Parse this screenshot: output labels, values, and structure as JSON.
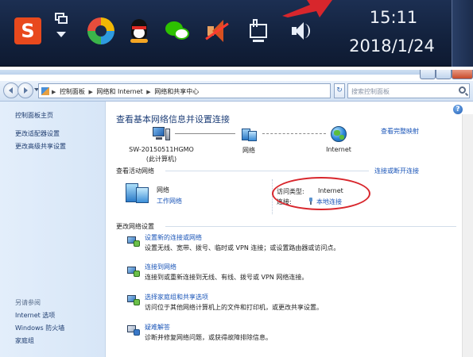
{
  "taskbar": {
    "time": "15:11",
    "date": "2018/1/24",
    "icons": [
      "sogou-input-icon",
      "switch-windows-icon",
      "colorful-ball-icon",
      "qq-icon",
      "wechat-icon",
      "speaker-muted-icon",
      "network-icon",
      "volume-icon"
    ],
    "sogou_glyph": "S",
    "annotation_color": "#d8262c"
  },
  "address_bar": {
    "crumbs": [
      "控制面板",
      "网络和 Internet",
      "网络和共享中心"
    ],
    "search_placeholder": "搜索控制面板"
  },
  "left_pane": {
    "home": "控制面板主页",
    "adapter": "更改适配器设置",
    "sharing": "更改高级共享设置",
    "see_also": "另请参阅",
    "internet_options": "Internet 选项",
    "firewall": "Windows 防火墙",
    "homegroup": "家庭组"
  },
  "main": {
    "title": "查看基本网络信息并设置连接",
    "full_map": "查看完整映射",
    "map": {
      "computer_name": "SW-20150511HGMO",
      "computer_sub": "(此计算机)",
      "network": "网络",
      "internet": "Internet"
    },
    "active": {
      "header": "查看活动网络",
      "connect_link": "连接或断开连接",
      "network_name": "网络",
      "network_type": "工作网络",
      "access_label": "访问类型:",
      "access_value": "Internet",
      "connections_label": "连接:",
      "connections_value": "本地连接"
    },
    "change": {
      "header": "更改网络设置",
      "tasks": [
        {
          "link": "设置新的连接或网络",
          "desc": "设置无线、宽带、拨号、临时或 VPN 连接；或设置路由器或访问点。"
        },
        {
          "link": "连接到网络",
          "desc": "连接到或重新连接到无线、有线、拨号或 VPN 网络连接。"
        },
        {
          "link": "选择家庭组和共享选项",
          "desc": "访问位于其他网络计算机上的文件和打印机，或更改共享设置。"
        },
        {
          "link": "疑难解答",
          "desc": "诊断并修复网络问题，或获得故障排除信息。"
        }
      ]
    },
    "help_glyph": "?"
  }
}
